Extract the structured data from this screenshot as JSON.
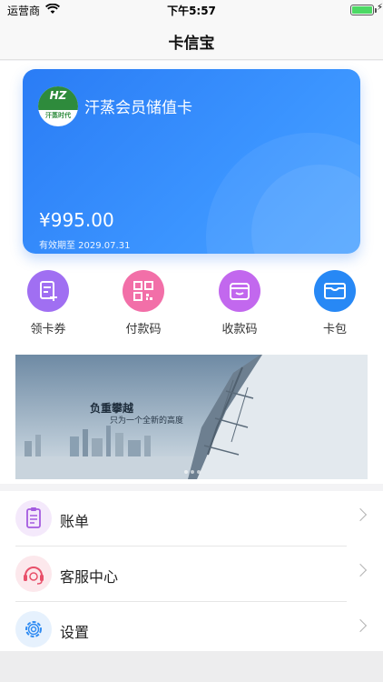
{
  "status_bar": {
    "carrier": "运营商",
    "time": "下午5:57"
  },
  "nav": {
    "title": "卡信宝"
  },
  "card": {
    "logo_mark": "HZ",
    "logo_text": "汗蒸时代",
    "name": "汗蒸会员储值卡",
    "balance": "¥995.00",
    "validity": "有效期至 2029.07.31"
  },
  "quick_actions": [
    {
      "label": "领卡券",
      "icon": "coupon-add-icon",
      "color": "#a06ff2"
    },
    {
      "label": "付款码",
      "icon": "qrcode-icon",
      "color": "#f26fa8"
    },
    {
      "label": "收款码",
      "icon": "receive-code-icon",
      "color": "#c268ee"
    },
    {
      "label": "卡包",
      "icon": "card-wallet-icon",
      "color": "#2788f5"
    }
  ],
  "banner": {
    "heading": "负重攀越",
    "subheading": "只为一个全新的高度"
  },
  "menu": [
    {
      "label": "账单",
      "icon": "bill-icon",
      "color": "#a45be0"
    },
    {
      "label": "客服中心",
      "icon": "support-headset-icon",
      "color": "#e8506a"
    },
    {
      "label": "设置",
      "icon": "settings-gear-icon",
      "color": "#2f8bf2"
    }
  ]
}
